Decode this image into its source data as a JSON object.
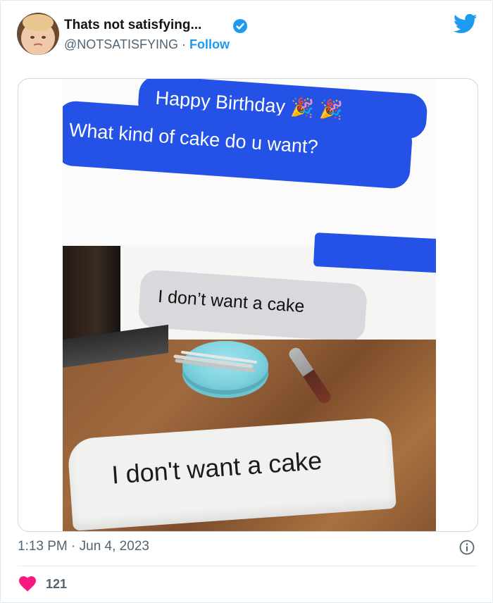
{
  "tweet": {
    "display_name": "Thats not satisfying...",
    "handle": "@NOTSATISFYING",
    "separator": "·",
    "follow_label": "Follow",
    "timestamp": "1:13 PM · Jun 4, 2023",
    "like_count": "121"
  },
  "media": {
    "bubble_happy": "Happy Birthday 🎉 🎉",
    "bubble_question": "What kind of cake do u want?",
    "bubble_answer": "I don’t want a cake",
    "cake_text": "I don't want a cake"
  },
  "colors": {
    "accent": "#1d9bf0",
    "heart": "#f91880",
    "imessage_blue": "#2451e6"
  },
  "icons": {
    "verified": "verified-badge-icon",
    "twitter": "twitter-bird-icon",
    "info": "info-icon",
    "like": "heart-icon"
  }
}
